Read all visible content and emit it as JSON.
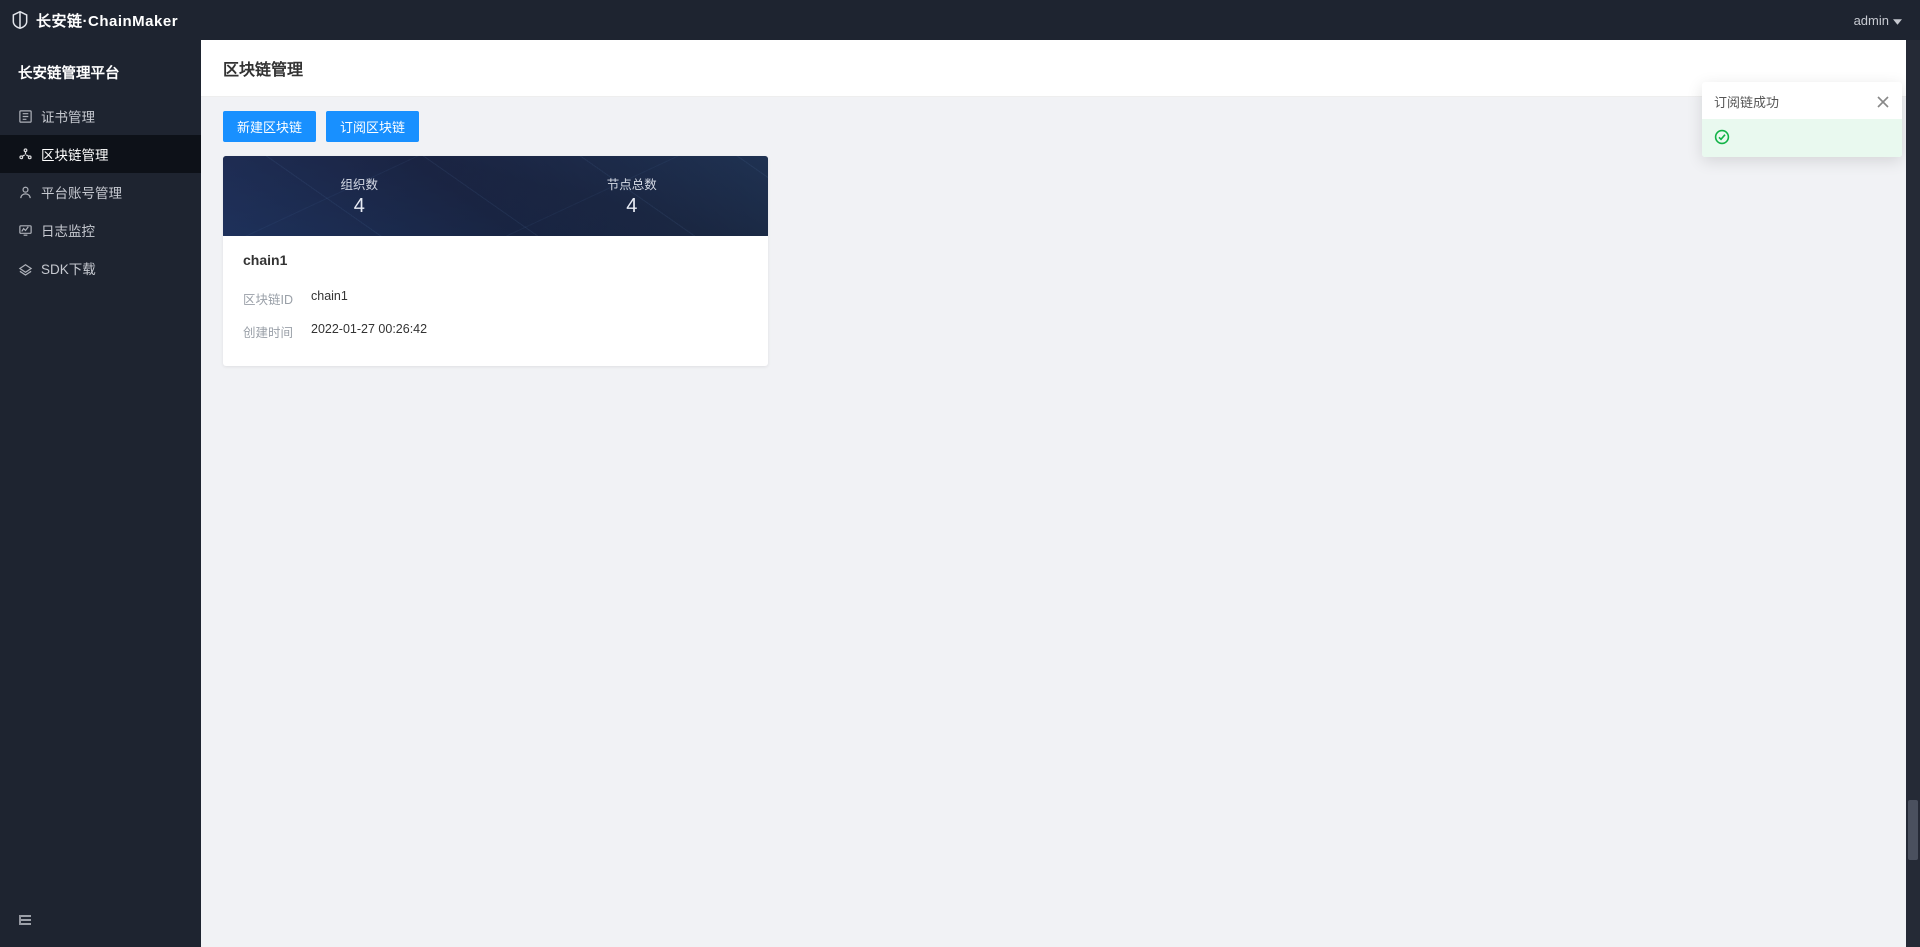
{
  "brand": {
    "cn": "长安链",
    "sep": "·",
    "en": "ChainMaker"
  },
  "header": {
    "user": "admin"
  },
  "sidebar": {
    "title": "长安链管理平台",
    "items": [
      {
        "label": "证书管理",
        "icon": "cert-icon"
      },
      {
        "label": "区块链管理",
        "icon": "blockchain-icon"
      },
      {
        "label": "平台账号管理",
        "icon": "user-icon"
      },
      {
        "label": "日志监控",
        "icon": "monitor-icon"
      },
      {
        "label": "SDK下载",
        "icon": "download-icon"
      }
    ],
    "activeIndex": 1
  },
  "page": {
    "title": "区块链管理",
    "buttons": {
      "create": "新建区块链",
      "subscribe": "订阅区块链"
    }
  },
  "cards": [
    {
      "stats": [
        {
          "label": "组织数",
          "value": "4"
        },
        {
          "label": "节点总数",
          "value": "4"
        }
      ],
      "name": "chain1",
      "rows": [
        {
          "key": "区块链ID",
          "value": "chain1"
        },
        {
          "key": "创建时间",
          "value": "2022-01-27 00:26:42"
        }
      ]
    }
  ],
  "toast": {
    "title": "订阅链成功"
  }
}
